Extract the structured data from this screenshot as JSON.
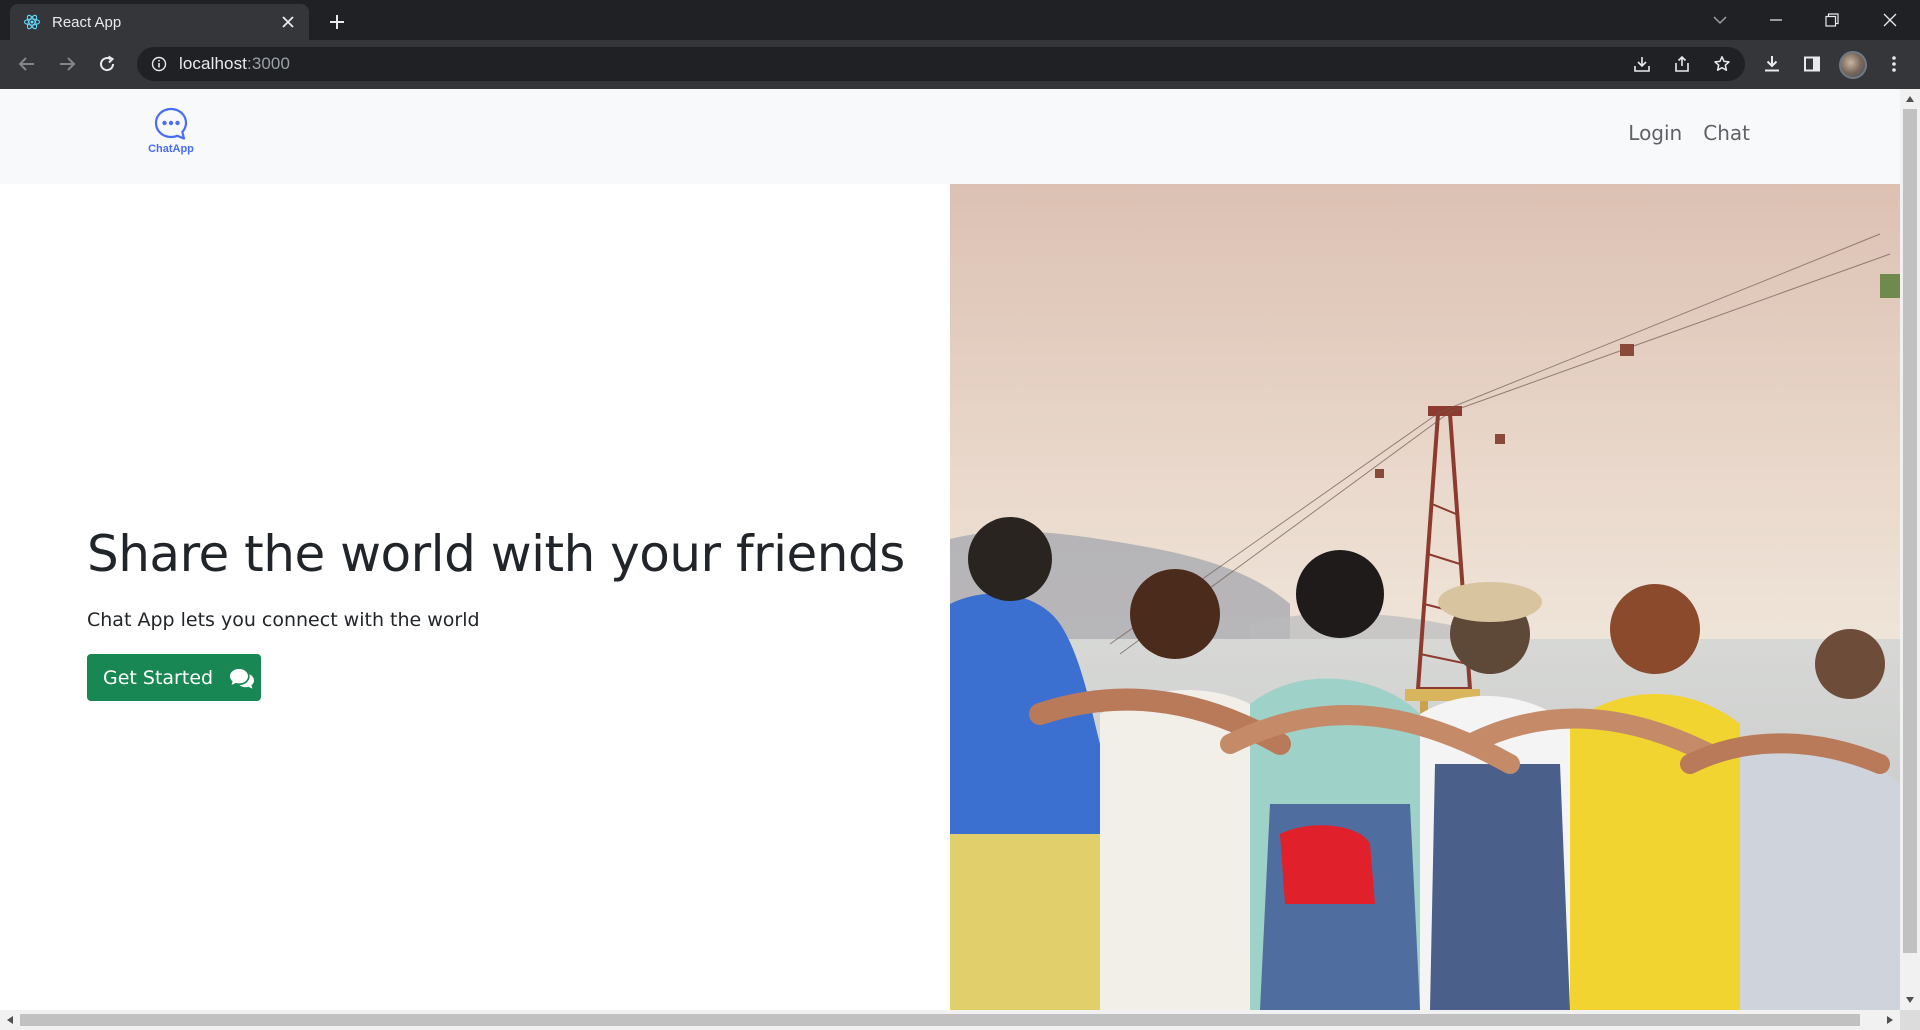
{
  "browser": {
    "tab_title": "React App",
    "url_host": "localhost",
    "url_port": ":3000"
  },
  "nav": {
    "brand": "ChatApp",
    "links": [
      "Login",
      "Chat"
    ]
  },
  "hero": {
    "title": "Share the world with your friends",
    "subtitle": "Chat App lets you connect with the world",
    "cta_label": "Get Started"
  },
  "colors": {
    "accent_green": "#198754",
    "brand_blue": "#4a6cf7",
    "navbar_bg": "#f8f9fa",
    "chrome_dark": "#202124"
  },
  "icons": {
    "tab_favicon": "react-logo-icon",
    "brand": "chat-bubble-dots-icon",
    "cta": "comments-icon"
  }
}
